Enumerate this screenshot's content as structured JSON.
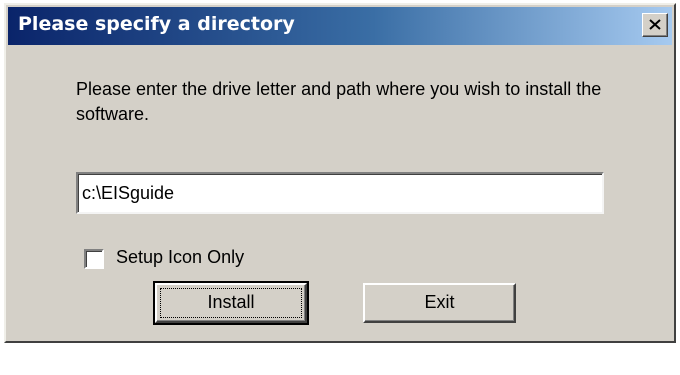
{
  "window": {
    "title": "Please specify a directory",
    "close_icon": "close-x-icon"
  },
  "dialog": {
    "instruction": "Please enter the drive letter and path where you wish to install the software.",
    "path_value": "c:\\EISguide",
    "checkbox_label": "Setup Icon Only",
    "checkbox_checked": false,
    "install_label": "Install",
    "exit_label": "Exit"
  },
  "colors": {
    "title_gradient_start": "#0a246a",
    "title_gradient_end": "#a6caf0",
    "face": "#d4d0c8"
  }
}
